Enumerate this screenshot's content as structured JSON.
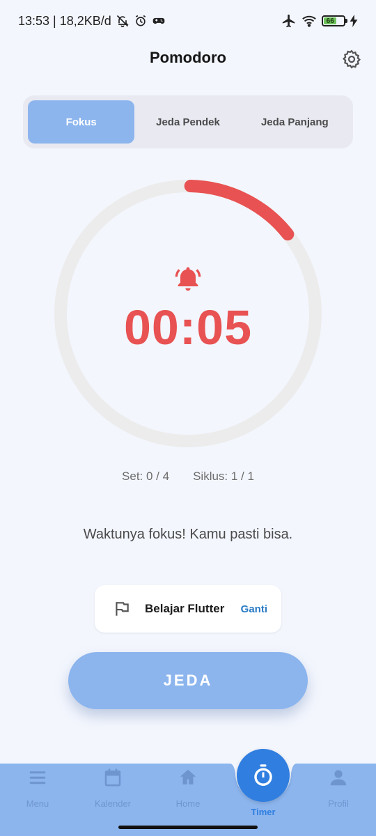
{
  "status_bar": {
    "time_net": "13:53 | 18,2KB/d",
    "battery_level": "66",
    "battery_fraction": 0.66
  },
  "header": {
    "title": "Pomodoro",
    "settings_icon": "gear-icon"
  },
  "tabs": [
    {
      "label": "Fokus",
      "active": true
    },
    {
      "label": "Jeda Pendek",
      "active": false
    },
    {
      "label": "Jeda Panjang",
      "active": false
    }
  ],
  "timer": {
    "display": "00:05",
    "progress_fraction": 0.14,
    "icon": "alarm-bell-icon",
    "color": "#e85252",
    "track_color": "#ececec"
  },
  "counters": {
    "set_text": "Set: 0 / 4",
    "cycle_text": "Siklus: 1 / 1"
  },
  "motivation": "Waktunya fokus! Kamu pasti bisa.",
  "task": {
    "name": "Belajar Flutter",
    "change_label": "Ganti",
    "icon": "flag-icon"
  },
  "pause_button": {
    "label": "JEDA",
    "color": "#8cb5ee"
  },
  "nav": {
    "items": [
      {
        "label": "Menu",
        "icon": "menu-icon"
      },
      {
        "label": "Kalender",
        "icon": "calendar-icon"
      },
      {
        "label": "Home",
        "icon": "home-icon"
      },
      {
        "label": "Timer",
        "icon": "stopwatch-icon",
        "active": true
      },
      {
        "label": "Profil",
        "icon": "person-icon"
      }
    ],
    "bar_color": "#8cb5ee",
    "active_color": "#2f7ee0"
  }
}
